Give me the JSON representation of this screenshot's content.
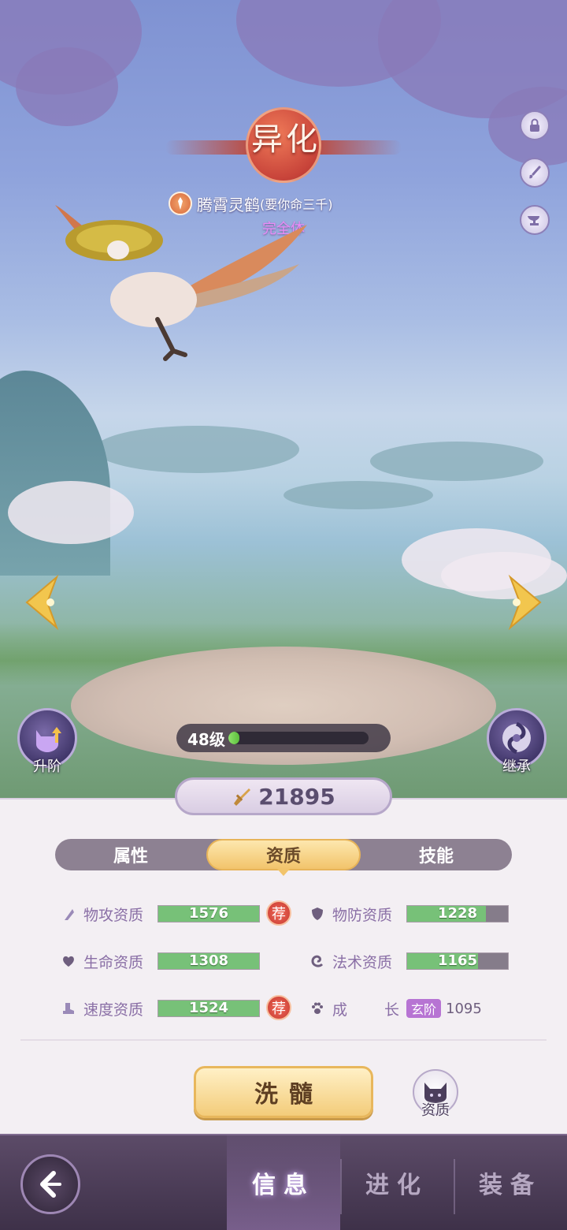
{
  "header": {
    "rarity_label": "异化",
    "pet_name": "腾霄灵鹤",
    "pet_owner": "(要你命三千)",
    "pet_form": "完全体"
  },
  "side_buttons": [
    {
      "name": "lock-icon"
    },
    {
      "name": "brush-icon"
    },
    {
      "name": "anvil-icon"
    }
  ],
  "scene": {
    "advance_label": "升阶",
    "inherit_label": "继承",
    "level_label": "48级",
    "level_progress": 0.08
  },
  "power": {
    "value": "21895",
    "icon": "sword-icon"
  },
  "tabs": {
    "attributes": "属性",
    "aptitude": "资质",
    "skills": "技能",
    "active": "资质"
  },
  "stats": {
    "phys_atk": {
      "label": "物攻资质",
      "value": "1576",
      "fill": 1.0,
      "recommend": "荐"
    },
    "phys_def": {
      "label": "物防资质",
      "value": "1228",
      "fill": 0.78
    },
    "hp": {
      "label": "生命资质",
      "value": "1308",
      "fill": 1.0
    },
    "mag_atk": {
      "label": "法术资质",
      "value": "1165",
      "fill": 0.7
    },
    "speed": {
      "label": "速度资质",
      "value": "1524",
      "fill": 1.0,
      "recommend": "荐"
    },
    "growth": {
      "label_a": "成",
      "label_b": "长",
      "tier": "玄阶",
      "value": "1095"
    }
  },
  "actions": {
    "wash": "洗髓",
    "aptitude_label": "资质"
  },
  "nav": {
    "info": "信息",
    "evolve": "进化",
    "equip": "装备",
    "active": "信息"
  }
}
